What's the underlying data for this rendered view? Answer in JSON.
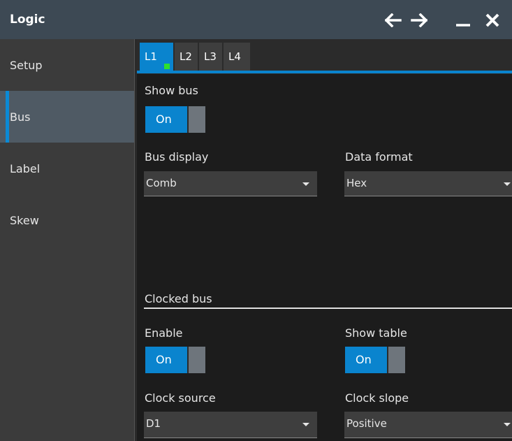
{
  "window": {
    "title": "Logic"
  },
  "titlebar_icons": [
    "arrow-left-icon",
    "arrow-right-icon",
    "minimize-icon",
    "close-icon"
  ],
  "sidebar": {
    "items": [
      {
        "label": "Setup",
        "active": false
      },
      {
        "label": "Bus",
        "active": true
      },
      {
        "label": "Label",
        "active": false
      },
      {
        "label": "Skew",
        "active": false
      }
    ]
  },
  "tabs": [
    {
      "label": "L1",
      "active": true
    },
    {
      "label": "L2",
      "active": false
    },
    {
      "label": "L3",
      "active": false
    },
    {
      "label": "L4",
      "active": false
    }
  ],
  "bus": {
    "show_bus_label": "Show bus",
    "show_bus_state": "On",
    "bus_display_label": "Bus display",
    "bus_display_value": "Comb",
    "data_format_label": "Data format",
    "data_format_value": "Hex"
  },
  "clocked_bus": {
    "section_title": "Clocked bus",
    "enable_label": "Enable",
    "enable_state": "On",
    "show_table_label": "Show table",
    "show_table_state": "On",
    "clock_source_label": "Clock source",
    "clock_source_value": "D1",
    "clock_slope_label": "Clock slope",
    "clock_slope_value": "Positive"
  },
  "colors": {
    "accent": "#0a84ce",
    "titlebar": "#3d4954",
    "sidebar": "#3b3b3b",
    "active_sidebar": "#4f5a64",
    "background": "#1c1c1c",
    "indicator": "#2ee02e"
  }
}
